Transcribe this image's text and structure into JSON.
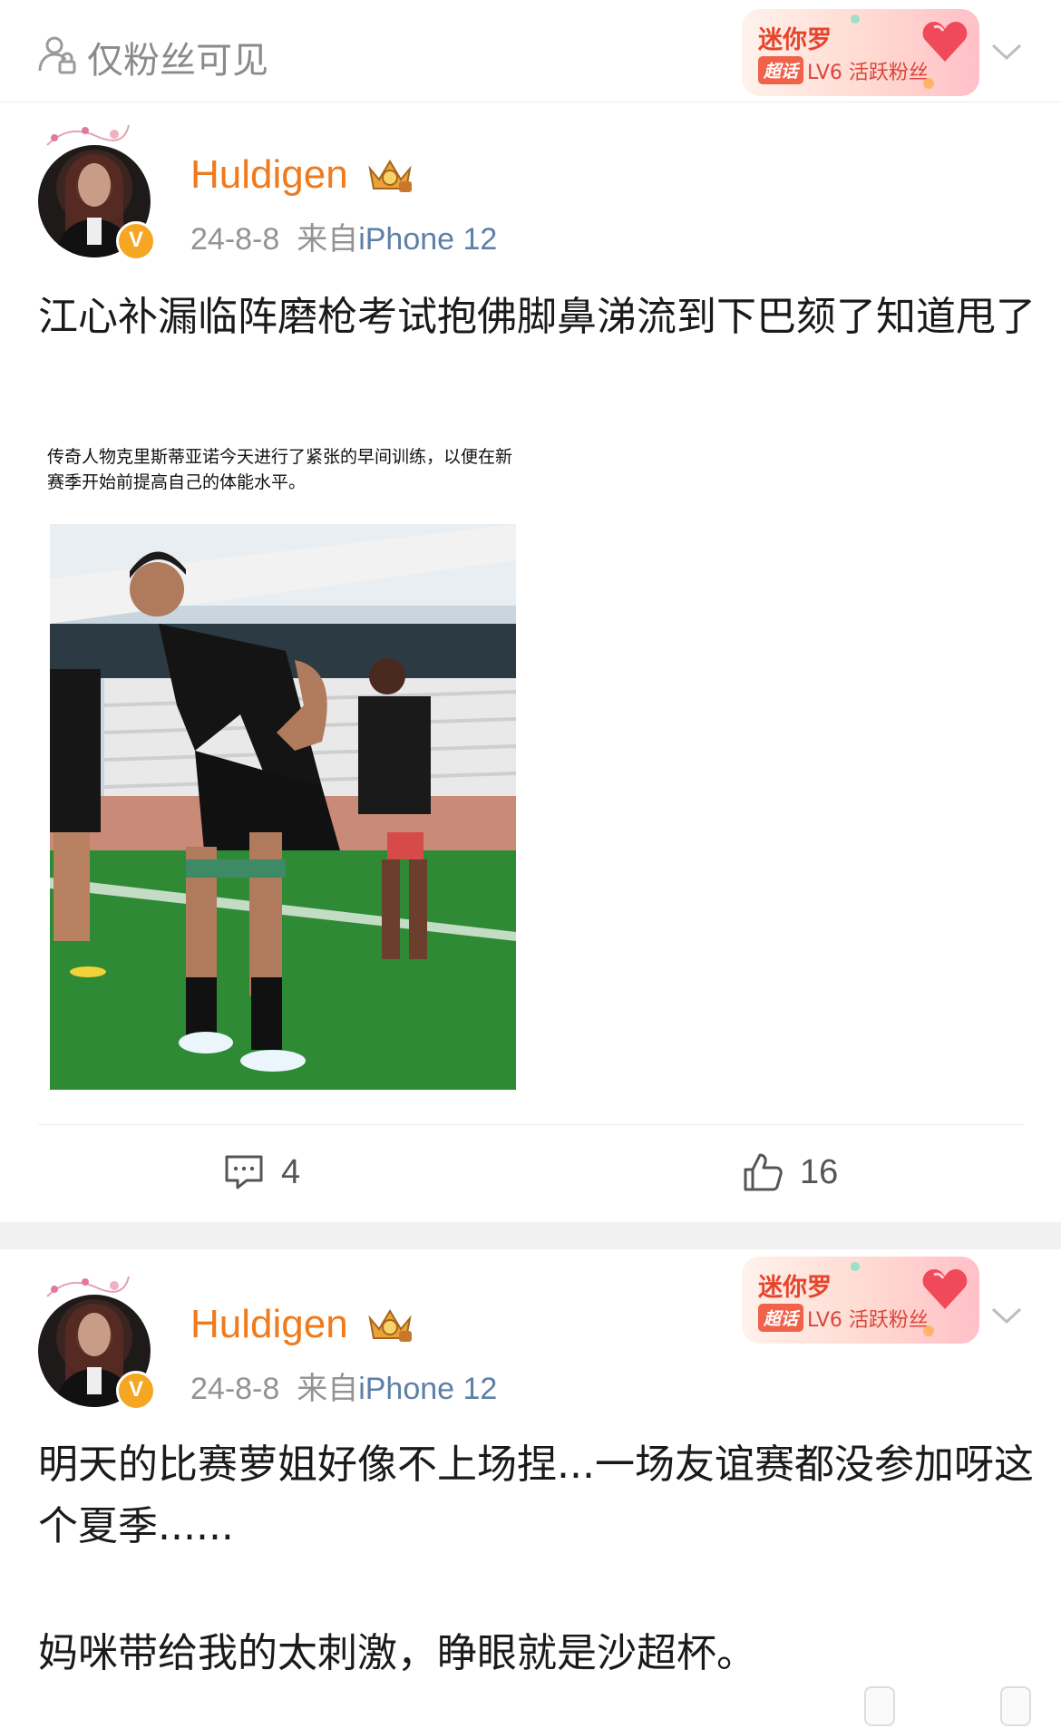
{
  "header": {
    "visibility_label": "仅粉丝可见",
    "lock_icon": "lock-people-icon"
  },
  "fan_badge": {
    "name": "迷你罗",
    "tag": "超话",
    "level": "LV6 活跃粉丝"
  },
  "posts": [
    {
      "username": "Huldigen",
      "date": "24-8-8",
      "source_prefix": "来自",
      "source": "iPhone 12",
      "text": "江心补漏临阵磨枪考试抱佛脚鼻涕流到下巴颏了知道甩了",
      "image_caption": "传奇人物克里斯蒂亚诺今天进行了紧张的早间训练，以便在新赛季开始前提高自己的体能水平。",
      "comments": "4",
      "likes": "16"
    },
    {
      "username": "Huldigen",
      "date": "24-8-8",
      "source_prefix": "来自",
      "source": "iPhone 12",
      "text_line1": "明天的比赛萝姐好像不上场捏...一场友谊赛都没参加呀这个夏季......",
      "text_line2": "妈咪带给我的太刺激，睁眼就是沙超杯。"
    }
  ],
  "colors": {
    "username": "#f07a1c",
    "meta": "#939393",
    "source": "#5d7fa8",
    "badge_red": "#e8442c",
    "verified": "#f5a623"
  }
}
